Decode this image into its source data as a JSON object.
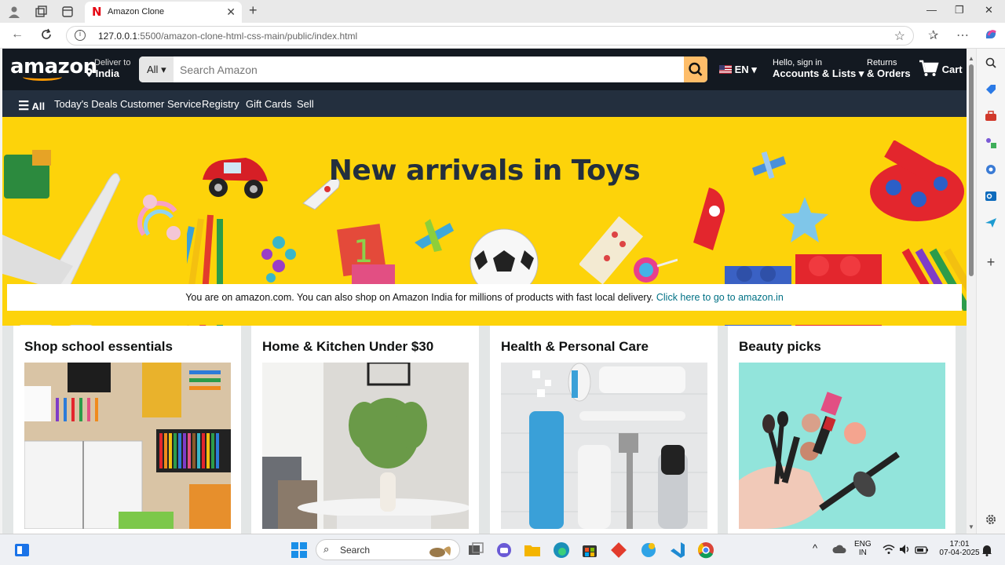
{
  "browser": {
    "tab_title": "Amazon Clone",
    "url_host": "127.0.0.1",
    "url_path": ":5500/amazon-clone-html-css-main/public/index.html",
    "favicon": "N"
  },
  "header": {
    "logo": "amazon",
    "deliver_line1": "Deliver to",
    "deliver_line2": "India",
    "search_category": "All",
    "search_placeholder": "Search Amazon",
    "lang": "EN",
    "account_line1": "Hello, sign in",
    "account_line2": "Accounts & Lists",
    "returns_line1": "Returns",
    "returns_line2": "& Orders",
    "cart": "Cart"
  },
  "subnav": {
    "all": "All",
    "items": [
      "Today's Deals",
      "Customer Service",
      "Registry",
      "Gift Cards",
      "Sell"
    ]
  },
  "hero": {
    "title": "New arrivals in Toys"
  },
  "notice": {
    "text": "You are on amazon.com. You can also shop on Amazon India for millions of products with fast local delivery. ",
    "link": "Click here to go to amazon.in"
  },
  "cards": [
    {
      "title": "Shop school essentials"
    },
    {
      "title": "Home & Kitchen Under $30"
    },
    {
      "title": "Health & Personal Care"
    },
    {
      "title": "Beauty picks"
    }
  ],
  "taskbar": {
    "search_label": "Search",
    "lang_line1": "ENG",
    "lang_line2": "IN",
    "time": "17:01",
    "date": "07-04-2025"
  },
  "colors": {
    "amazon_dark": "#131921",
    "amazon_nav": "#232f3e",
    "amazon_orange": "#febd69",
    "hero_yellow": "#fdd30a",
    "link_teal": "#007185"
  }
}
